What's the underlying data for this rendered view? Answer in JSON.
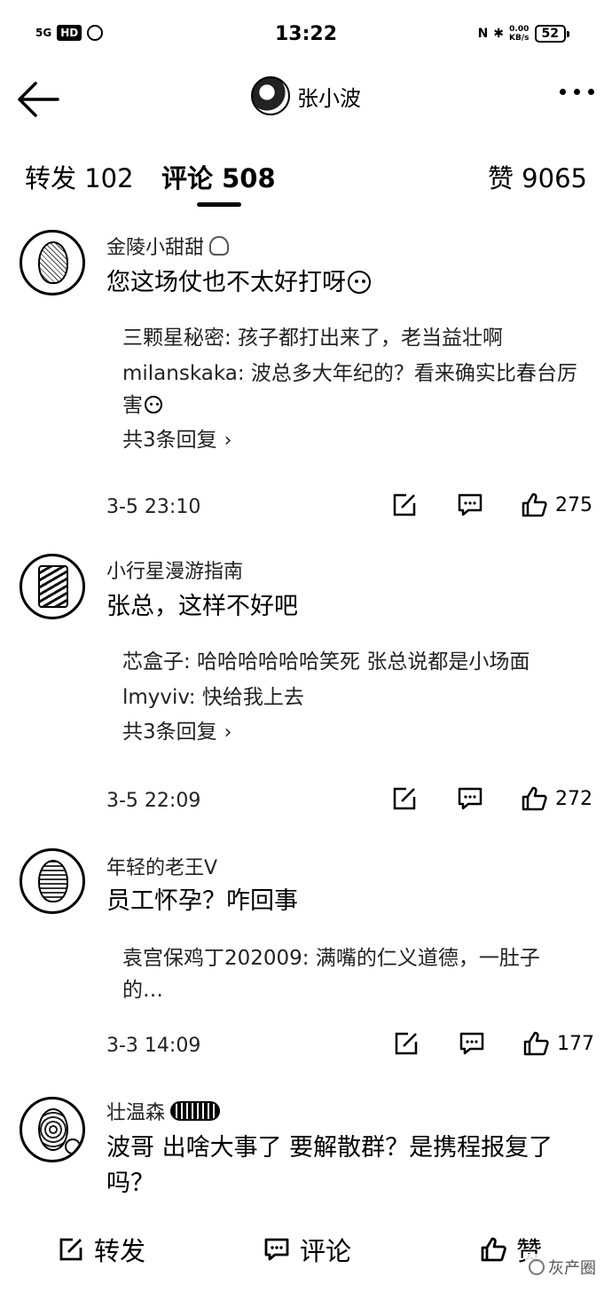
{
  "status_bar": {
    "signal": "5G",
    "hd": "HD",
    "time": "13:22",
    "network_speed": "0.00\nKB/s",
    "battery": "52"
  },
  "nav": {
    "title": "张小波"
  },
  "tabs": {
    "repost": "转发 102",
    "comment": "评论 508",
    "like": "赞 9065"
  },
  "comments": [
    {
      "name": "金陵小甜甜",
      "text": "您这场仗也不太好打呀",
      "replies": [
        "三颗星秘密: 孩子都打出来了，老当益壮啊",
        "milanskaka: 波总多大年纪的？看来确实比春台厉害"
      ],
      "more_replies": "共3条回复",
      "time": "3-5 23:10",
      "likes": "275"
    },
    {
      "name": "小行星漫游指南",
      "text": "张总，这样不好吧",
      "replies": [
        "芯盒子: 哈哈哈哈哈哈笑死 张总说都是小场面",
        "lmyviv: 快给我上去"
      ],
      "more_replies": "共3条回复",
      "time": "3-5 22:09",
      "likes": "272"
    },
    {
      "name": "年轻的老王V",
      "text": "员工怀孕？咋回事",
      "replies": [
        "袁宫保鸡丁202009: 满嘴的仁义道德，一肚子的…"
      ],
      "time": "3-3 14:09",
      "likes": "177"
    },
    {
      "name": "壮温森",
      "text": "波哥 出啥大事了 要解散群？是携程报复了吗？"
    }
  ],
  "bottom_bar": {
    "repost": "转发",
    "comment": "评论",
    "like": "赞"
  },
  "watermark": "灰产圈"
}
